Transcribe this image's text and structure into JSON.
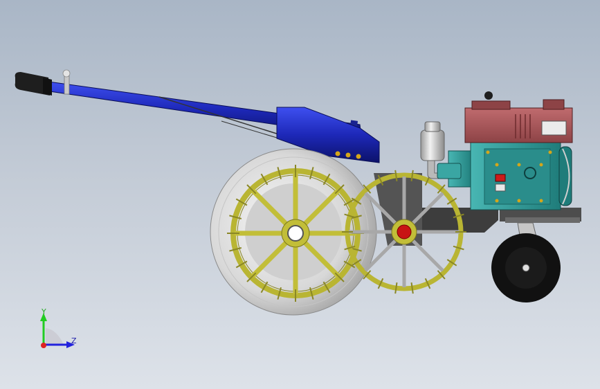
{
  "triad": {
    "y_label": "Y",
    "z_label": "Z",
    "y_color": "#22cc22",
    "z_color": "#2222dd",
    "origin_color": "#dd2222"
  },
  "colors": {
    "handle": "#1d28b8",
    "grip": "#1e1e1e",
    "engine_body": "#2e9c9a",
    "engine_top": "#a85558",
    "wheel_rim": "#b9b533",
    "drum": "#dcdcdc",
    "frame": "#4a4a4a"
  }
}
